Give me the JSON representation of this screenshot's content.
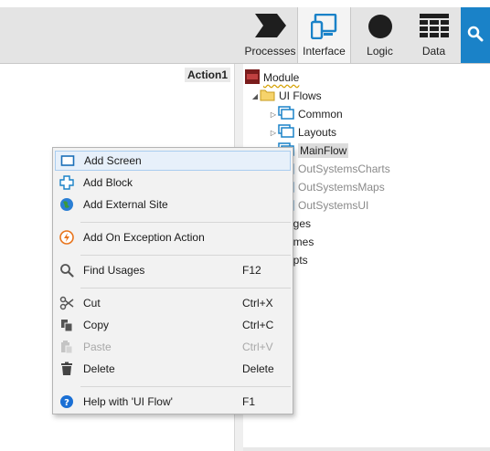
{
  "toolbar": {
    "tabs": [
      {
        "label": "Processes",
        "icon": "processes-chevron-icon"
      },
      {
        "label": "Interface",
        "icon": "interface-devices-icon",
        "active": true
      },
      {
        "label": "Logic",
        "icon": "logic-circle-icon"
      },
      {
        "label": "Data",
        "icon": "data-grid-icon"
      }
    ],
    "search_icon": "search-icon",
    "accent": "#1a82c8"
  },
  "canvas": {
    "action_title": "Action1"
  },
  "tree": {
    "module": "Module",
    "ui_flows": "UI Flows",
    "common": "Common",
    "layouts": "Layouts",
    "mainflow": "MainFlow",
    "charts": "OutSystemsCharts",
    "maps": "OutSystemsMaps",
    "ui": "OutSystemsUI",
    "images": "ages",
    "themes": "emes",
    "scripts": "ipts"
  },
  "context_menu": {
    "items": [
      {
        "label": "Add Screen",
        "shortcut": "",
        "icon": "screen-icon",
        "enabled": true,
        "highlighted": true
      },
      {
        "label": "Add Block",
        "shortcut": "",
        "icon": "block-icon",
        "enabled": true
      },
      {
        "label": "Add External Site",
        "shortcut": "",
        "icon": "globe-icon",
        "enabled": true
      },
      {
        "label": "Add On Exception Action",
        "shortcut": "",
        "icon": "exception-icon",
        "enabled": true
      },
      {
        "label": "Find Usages",
        "shortcut": "F12",
        "icon": "magnifier-icon",
        "enabled": true
      },
      {
        "label": "Cut",
        "shortcut": "Ctrl+X",
        "icon": "scissors-icon",
        "enabled": true
      },
      {
        "label": "Copy",
        "shortcut": "Ctrl+C",
        "icon": "copy-icon",
        "enabled": true
      },
      {
        "label": "Paste",
        "shortcut": "Ctrl+V",
        "icon": "paste-icon",
        "enabled": false
      },
      {
        "label": "Delete",
        "shortcut": "Delete",
        "icon": "trash-icon",
        "enabled": true
      },
      {
        "label": "Help with 'UI Flow'",
        "shortcut": "F1",
        "icon": "help-icon",
        "enabled": true
      }
    ]
  }
}
